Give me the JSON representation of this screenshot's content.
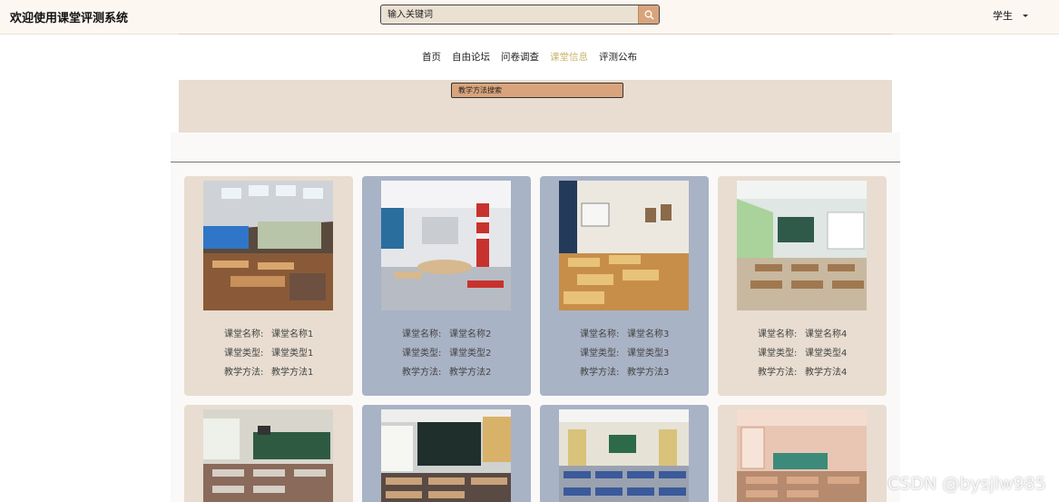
{
  "header": {
    "app_title": "欢迎使用课堂评测系统",
    "search_placeholder": "输入关键词",
    "search_icon": "search-icon",
    "user_label": "学生",
    "user_caret_icon": "caret-down-icon"
  },
  "nav": {
    "items": [
      {
        "label": "首页",
        "active": false
      },
      {
        "label": "自由论坛",
        "active": false
      },
      {
        "label": "问卷调查",
        "active": false
      },
      {
        "label": "课堂信息",
        "active": true
      },
      {
        "label": "评测公布",
        "active": false
      }
    ],
    "active_color": "#c8b56a"
  },
  "filter": {
    "method_search_label": "教学方法搜索"
  },
  "labels": {
    "name": "课堂名称:",
    "type": "课堂类型:",
    "method": "教学方法:"
  },
  "colors": {
    "card_beige": "#e8ddd0",
    "card_blue": "#a9b3c6",
    "accent_button": "#d9a47c",
    "header_bg": "#fdf7f2"
  },
  "cards": [
    {
      "name": "课堂名称1",
      "type": "课堂类型1",
      "method": "教学方法1",
      "photo": "lecture-hall-photo"
    },
    {
      "name": "课堂名称2",
      "type": "课堂类型2",
      "method": "教学方法2",
      "photo": "modern-classroom-photo"
    },
    {
      "name": "课堂名称3",
      "type": "课堂类型3",
      "method": "教学方法3",
      "photo": "classroom-with-projector-photo"
    },
    {
      "name": "课堂名称4",
      "type": "课堂类型4",
      "method": "教学方法4",
      "photo": "green-wall-classroom-photo"
    },
    {
      "name": "",
      "type": "",
      "method": "",
      "photo": "classroom-chalkboard-photo"
    },
    {
      "name": "",
      "type": "",
      "method": "",
      "photo": "classroom-map-blackboard-photo"
    },
    {
      "name": "",
      "type": "",
      "method": "",
      "photo": "classroom-blue-desks-photo"
    },
    {
      "name": "",
      "type": "",
      "method": "",
      "photo": "warm-lit-classroom-photo"
    }
  ],
  "watermark": "CSDN @bysjlw985"
}
